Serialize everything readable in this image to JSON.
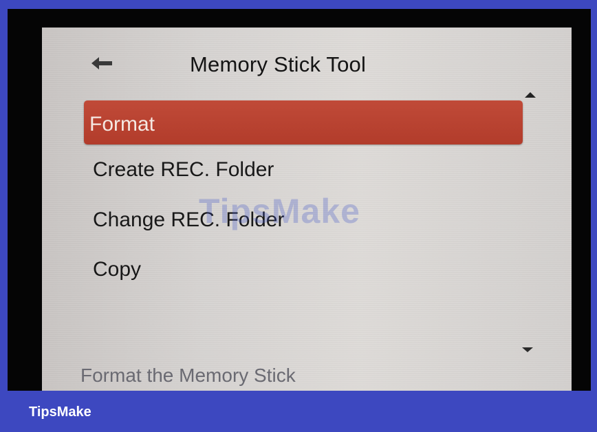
{
  "screen": {
    "back_icon": "arrow-left-icon",
    "title": "Memory Stick Tool",
    "scroll_up_icon": "triangle-up-icon",
    "scroll_down_icon": "triangle-down-icon"
  },
  "menu": {
    "items": [
      {
        "label": "Format",
        "selected": true
      },
      {
        "label": "Create REC. Folder",
        "selected": false
      },
      {
        "label": "Change REC. Folder",
        "selected": false
      },
      {
        "label": "Copy",
        "selected": false
      }
    ]
  },
  "hint": "Format the Memory Stick",
  "colors": {
    "frame": "#3d48c0",
    "highlight": "#b9412f",
    "screen_bg": "#d6d3d1",
    "text": "#181818"
  },
  "footer": {
    "brand": "TipsMake"
  }
}
